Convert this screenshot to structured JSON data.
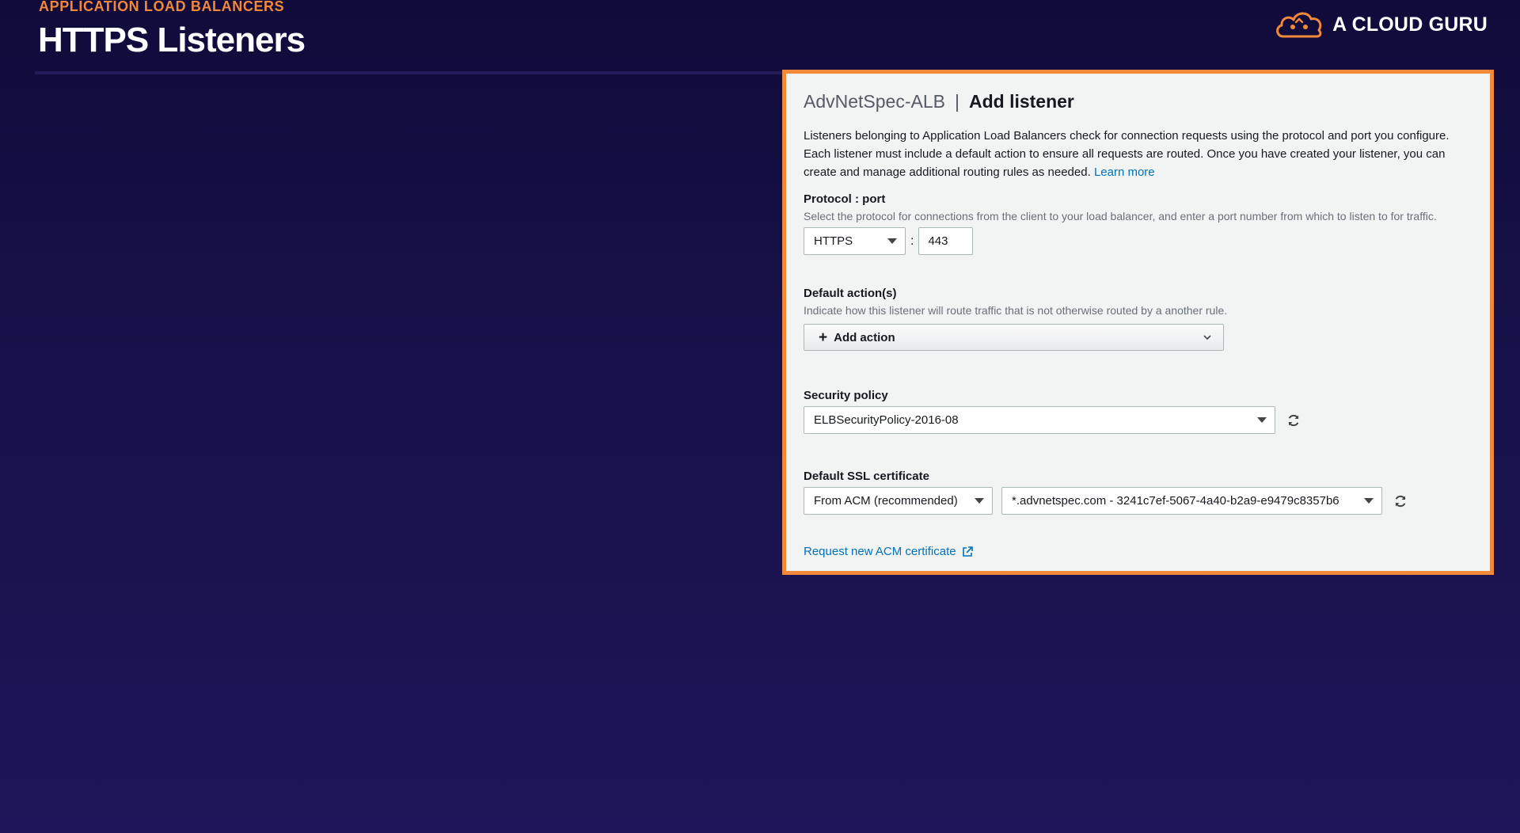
{
  "slide": {
    "eyebrow": "APPLICATION LOAD BALANCERS",
    "title": "HTTPS Listeners",
    "brand": "A CLOUD GURU",
    "accent_color": "#f2883a"
  },
  "panel": {
    "load_balancer": "AdvNetSpec-ALB",
    "separator": "|",
    "action_title": "Add listener",
    "intro": "Listeners belonging to Application Load Balancers check for connection requests using the protocol and port you configure. Each listener must include a default action to ensure all requests are routed. Once you have created your listener, you can create and manage additional routing rules as needed.",
    "learn_more": "Learn more",
    "protocol_port": {
      "label": "Protocol : port",
      "description": "Select the protocol for connections from the client to your load balancer, and enter a port number from which to listen to for traffic.",
      "protocol_value": "HTTPS",
      "colon": ":",
      "port_value": "443"
    },
    "default_actions": {
      "label": "Default action(s)",
      "description": "Indicate how this listener will route traffic that is not otherwise routed by a another rule.",
      "add_action_label": "Add action"
    },
    "security_policy": {
      "label": "Security policy",
      "value": "ELBSecurityPolicy-2016-08"
    },
    "ssl_certificate": {
      "label": "Default SSL certificate",
      "source_value": "From ACM (recommended)",
      "certificate_value": "*.advnetspec.com - 3241c7ef-5067-4a40-b2a9-e9479c8357b6"
    },
    "request_cert_link": "Request new ACM certificate"
  }
}
